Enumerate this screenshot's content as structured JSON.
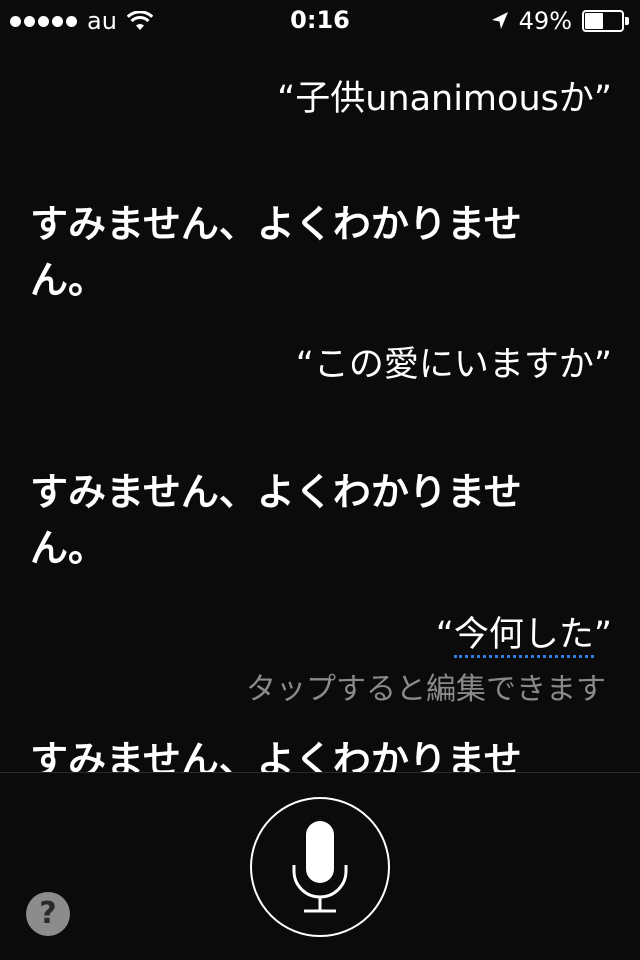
{
  "status_bar": {
    "carrier": "au",
    "time": "0:16",
    "battery_percent_text": "49%",
    "battery_level": 0.49,
    "icons": [
      "signal-dots-icon",
      "wifi-icon",
      "location-arrow-icon",
      "battery-icon"
    ]
  },
  "conversation": {
    "query_1": "“子供unanimousか”",
    "reply_1": "すみません、よくわかりません。",
    "query_2": "“この愛にいますか”",
    "reply_2": "すみません、よくわかりません。",
    "query_3_open": "“",
    "query_3_text": "今何した",
    "query_3_close": "”",
    "edit_hint": "タップすると編集できます",
    "reply_3": "すみません、よくわかりません。"
  },
  "controls": {
    "help_label": "?",
    "icons": [
      "microphone-icon"
    ]
  },
  "colors": {
    "background": "#0b0b0c",
    "text": "#ffffff",
    "hint_text": "#8a8a8a",
    "edit_underline": "#2f7de1"
  }
}
